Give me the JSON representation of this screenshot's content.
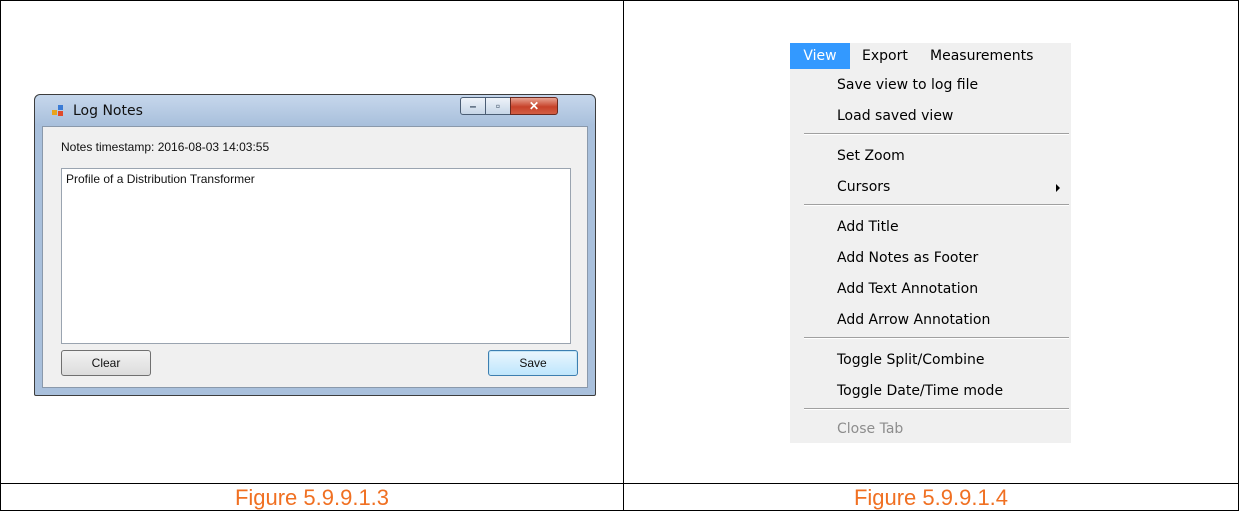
{
  "figures": {
    "left_caption": "Figure 5.9.9.1.3",
    "right_caption": "Figure 5.9.9.1.4"
  },
  "log_notes_window": {
    "title": "Log Notes",
    "timestamp_label": "Notes timestamp: 2016-08-03 14:03:55",
    "notes_text": "Profile of a Distribution Transformer",
    "clear_label": "Clear",
    "save_label": "Save",
    "icons": [
      "app-icon",
      "minimize-icon",
      "maximize-icon",
      "close-icon"
    ]
  },
  "menu": {
    "menubar": [
      "View",
      "Export",
      "Measurements"
    ],
    "active": "View",
    "items": [
      "Save view to log file",
      "Load saved view",
      "Set Zoom",
      "Cursors",
      "Add Title",
      "Add Notes as Footer",
      "Add Text Annotation",
      "Add Arrow Annotation",
      "Toggle Split/Combine",
      "Toggle Date/Time mode",
      "Close Tab"
    ],
    "disabled_items": [
      "Close Tab"
    ],
    "submenu_items": [
      "Cursors"
    ]
  },
  "colors": {
    "caption": "#f07022",
    "menu_highlight": "#3399ff",
    "window_frame": "#a9c0dc"
  }
}
